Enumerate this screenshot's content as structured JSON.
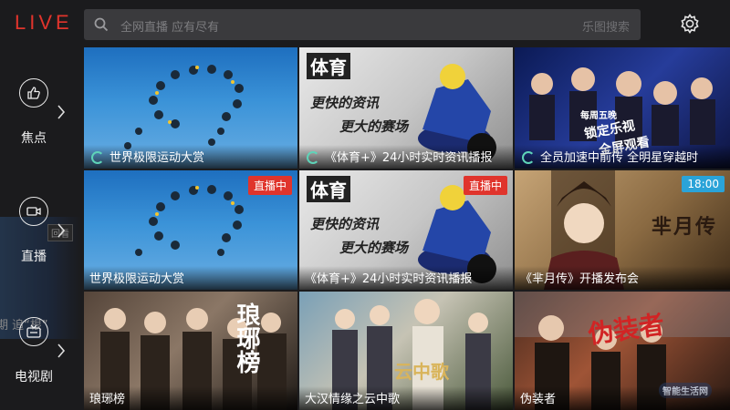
{
  "header": {
    "logo": "LIVE",
    "search_placeholder": "全网直播 应有尽有",
    "search_hint": "乐图搜索"
  },
  "sidebar": {
    "background_tag": "回看",
    "background_text": "期 追“根”",
    "items": [
      {
        "label": "焦点",
        "icon": "thumbs-up-icon"
      },
      {
        "label": "直播",
        "icon": "video-camera-icon"
      },
      {
        "label": "电视剧",
        "icon": "tv-icon"
      }
    ]
  },
  "tiles": {
    "r1c1": {
      "caption": "世界极限运动大赏"
    },
    "r1c2": {
      "caption": "《体育+》24小时实时资讯播报",
      "brand": "体育",
      "slogan1": "更快的资讯",
      "slogan2": "更大的赛场"
    },
    "r1c3": {
      "caption": "全员加速中前传 全明星穿越时",
      "art_line1": "每周五晚",
      "art_line2": "锁定乐视",
      "art_line3": "全屏观看"
    },
    "r2c1": {
      "caption": "世界极限运动大赏",
      "badge": "直播中"
    },
    "r2c2": {
      "caption": "《体育+》24小时实时资讯播报",
      "badge": "直播中",
      "brand": "体育",
      "slogan1": "更快的资讯",
      "slogan2": "更大的赛场"
    },
    "r2c3": {
      "caption": "《芈月传》开播发布会",
      "badge": "18:00",
      "art_title": "芈月传"
    },
    "r3c1": {
      "caption": "琅琊榜",
      "art_title": "琅琊榜"
    },
    "r3c2": {
      "caption": "大汉情缘之云中歌",
      "art_title": "云中歌"
    },
    "r3c3": {
      "caption": "伪装者",
      "art_title": "伪装者",
      "watermark": "智能生活网"
    }
  },
  "colors": {
    "accent": "#e0342c",
    "live_badge": "#e0342c",
    "time_badge": "#2aa3d8",
    "spinner": "#5fd3b8"
  }
}
